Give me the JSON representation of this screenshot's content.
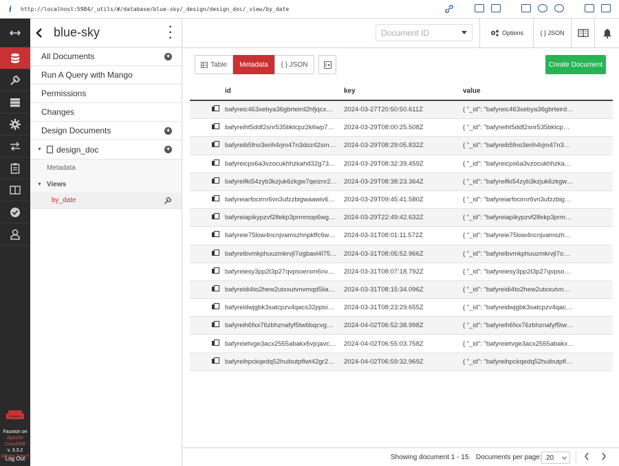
{
  "browser": {
    "info_icon": "i",
    "url": "http://localhost:5984/_utils/#/database/blue-sky/_design/design_doc/_view/by_date"
  },
  "leftnav": {
    "items": [
      "expand-icon",
      "database-icon",
      "wrench-icon",
      "server-icon",
      "gear-icon",
      "replication-icon",
      "clipboard-icon",
      "book-icon",
      "check-icon",
      "user-icon"
    ],
    "brand_line1": "Fauxton on",
    "brand_line2": "Apache",
    "brand_line3": "CouchDB",
    "version": "v. 3.3.2",
    "whats_new": "What's New?",
    "logout": "Log Out"
  },
  "sidebar": {
    "db_name": "blue-sky",
    "items": [
      "All Documents",
      "Run A Query with Mango",
      "Permissions",
      "Changes",
      "Design Documents"
    ],
    "design_doc": "design_doc",
    "metadata": "Metadata",
    "views_label": "Views",
    "active_view": "by_date"
  },
  "header": {
    "doc_id_placeholder": "Document ID",
    "options_label": "Options",
    "json_label": "{ } JSON"
  },
  "toolbar": {
    "table_label": "Table",
    "metadata_label": "Metadata",
    "json_label": "{ } JSON",
    "create_label": "Create Document"
  },
  "table": {
    "columns": [
      "id",
      "key",
      "value"
    ],
    "rows": [
      {
        "id": "bafyreic463xebya36gbrteird2hfjqcx…",
        "key": "2024-03-27T20:50:50.611Z",
        "value": "{ \"_id\": \"bafyreic463xebya36gbrteird…"
      },
      {
        "id": "bafyreiht5ddf2snr535bktcpz2k6wp7…",
        "key": "2024-03-29T08:00:25.508Z",
        "value": "{ \"_id\": \"bafyreiht5ddf2snr535bktcp…"
      },
      {
        "id": "bafyreib5fno3erih4rjm47n3doz42sm…",
        "key": "2024-03-29T08:29:05.832Z",
        "value": "{ \"_id\": \"bafyreib5fno3erih4rjm47n3…"
      },
      {
        "id": "bafyreicps6a3vzocukhhzkahd32g73…",
        "key": "2024-03-29T08:32:39.459Z",
        "value": "{ \"_id\": \"bafyreicps6a3vzocukhhzka…"
      },
      {
        "id": "bafyreifki54zyb3kzjuk6zkgw7qeiznr2…",
        "key": "2024-03-29T08:38:23.364Z",
        "value": "{ \"_id\": \"bafyreifki54zyb3kzjuk6zkgw…"
      },
      {
        "id": "bafyreiarfocirnr6vn3ufzzbigwaawiv6…",
        "key": "2024-03-29T09:45:41.580Z",
        "value": "{ \"_id\": \"bafyreiarfocirnr6vn3ufzzbig…"
      },
      {
        "id": "bafyreiapikypzvf2lfekp3prmmop6wg…",
        "key": "2024-03-29T22:49:42.632Z",
        "value": "{ \"_id\": \"bafyreiapikypzvf2lfekp3prm…"
      },
      {
        "id": "bafyreie75low4ncnjvamszhnpkffc6w…",
        "key": "2024-03-31T08:01:11.572Z",
        "value": "{ \"_id\": \"bafyreie75low4ncnjvamszh…"
      },
      {
        "id": "bafyreibvmkphuuzmkrvjl7ogbavl4l75…",
        "key": "2024-03-31T08:05:52.966Z",
        "value": "{ \"_id\": \"bafyreibvmkphuuzmkrvjl7o…"
      },
      {
        "id": "bafyreiesy3pp2t3p27qvpsoerxm6nv…",
        "key": "2024-03-31T08:07:18.792Z",
        "value": "{ \"_id\": \"bafyreiesy3pp2t3p27qvpso…"
      },
      {
        "id": "bafyreidi4to2hew2utxxutvnvmqd5lia…",
        "key": "2024-03-31T08:15:34.096Z",
        "value": "{ \"_id\": \"bafyreidi4to2hew2utxxutvn…"
      },
      {
        "id": "bafyreidwjgbk3satcpzv4qacs32ppoi…",
        "key": "2024-03-31T08:23:29.655Z",
        "value": "{ \"_id\": \"bafyreidwjgbk3satcpzv4qac…"
      },
      {
        "id": "bafyreih6fxx76zbhznafyf5tw6bqcvg…",
        "key": "2024-04-02T06:52:38.998Z",
        "value": "{ \"_id\": \"bafyreih6fxx76zbhznafyf5tw…"
      },
      {
        "id": "bafyreietvge3acx2555abakx6vjcjavc…",
        "key": "2024-04-02T06:55:03.758Z",
        "value": "{ \"_id\": \"bafyreietvge3acx2555abakx…"
      },
      {
        "id": "bafyreihpckqedq52huibutpflwt42gr2…",
        "key": "2024-04-02T06:59:32.969Z",
        "value": "{ \"_id\": \"bafyreihpckqedq52huibutpfl…"
      }
    ]
  },
  "footer": {
    "showing": "Showing document 1 - 15.",
    "per_page_label": "Documents per page:",
    "per_page_value": "20"
  },
  "colors": {
    "accent": "#c93133",
    "create": "#27b454",
    "nav_bg": "#2a2a2a"
  }
}
